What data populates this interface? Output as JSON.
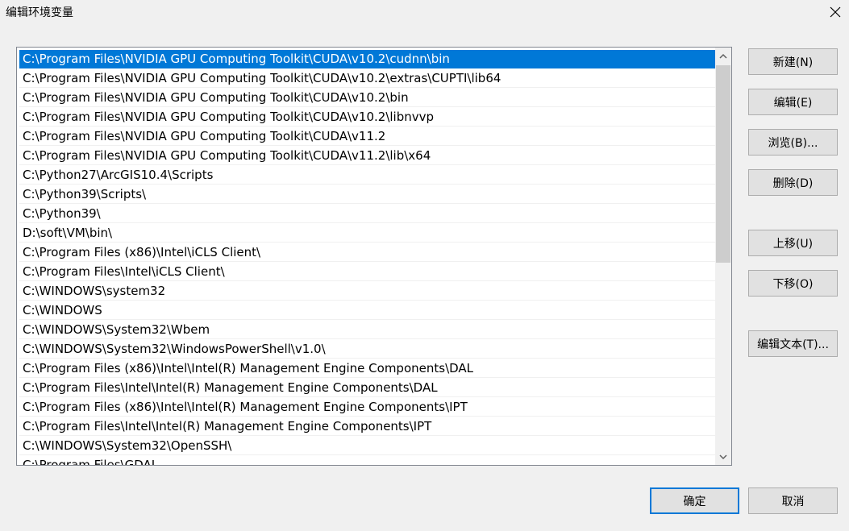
{
  "window": {
    "title": "编辑环境变量"
  },
  "paths": [
    "C:\\Program Files\\NVIDIA GPU Computing Toolkit\\CUDA\\v10.2\\cudnn\\bin",
    "C:\\Program Files\\NVIDIA GPU Computing Toolkit\\CUDA\\v10.2\\extras\\CUPTI\\lib64",
    "C:\\Program Files\\NVIDIA GPU Computing Toolkit\\CUDA\\v10.2\\bin",
    "C:\\Program Files\\NVIDIA GPU Computing Toolkit\\CUDA\\v10.2\\libnvvp",
    "C:\\Program Files\\NVIDIA GPU Computing Toolkit\\CUDA\\v11.2",
    "C:\\Program Files\\NVIDIA GPU Computing Toolkit\\CUDA\\v11.2\\lib\\x64",
    "C:\\Python27\\ArcGIS10.4\\Scripts",
    "C:\\Python39\\Scripts\\",
    "C:\\Python39\\",
    "D:\\soft\\VM\\bin\\",
    "C:\\Program Files (x86)\\Intel\\iCLS Client\\",
    "C:\\Program Files\\Intel\\iCLS Client\\",
    "C:\\WINDOWS\\system32",
    "C:\\WINDOWS",
    "C:\\WINDOWS\\System32\\Wbem",
    "C:\\WINDOWS\\System32\\WindowsPowerShell\\v1.0\\",
    "C:\\Program Files (x86)\\Intel\\Intel(R) Management Engine Components\\DAL",
    "C:\\Program Files\\Intel\\Intel(R) Management Engine Components\\DAL",
    "C:\\Program Files (x86)\\Intel\\Intel(R) Management Engine Components\\IPT",
    "C:\\Program Files\\Intel\\Intel(R) Management Engine Components\\IPT",
    "C:\\WINDOWS\\System32\\OpenSSH\\",
    "C:\\Program Files\\GDAL"
  ],
  "selected_index": 0,
  "buttons": {
    "new": "新建(N)",
    "edit": "编辑(E)",
    "browse": "浏览(B)...",
    "delete": "删除(D)",
    "move_up": "上移(U)",
    "move_down": "下移(O)",
    "edit_text": "编辑文本(T)...",
    "ok": "确定",
    "cancel": "取消"
  },
  "icons": {
    "close": "close-icon",
    "scroll_up": "chevron-up-icon",
    "scroll_down": "chevron-down-icon"
  },
  "colors": {
    "selection": "#0078d7",
    "default_button_border": "#0078d7"
  }
}
